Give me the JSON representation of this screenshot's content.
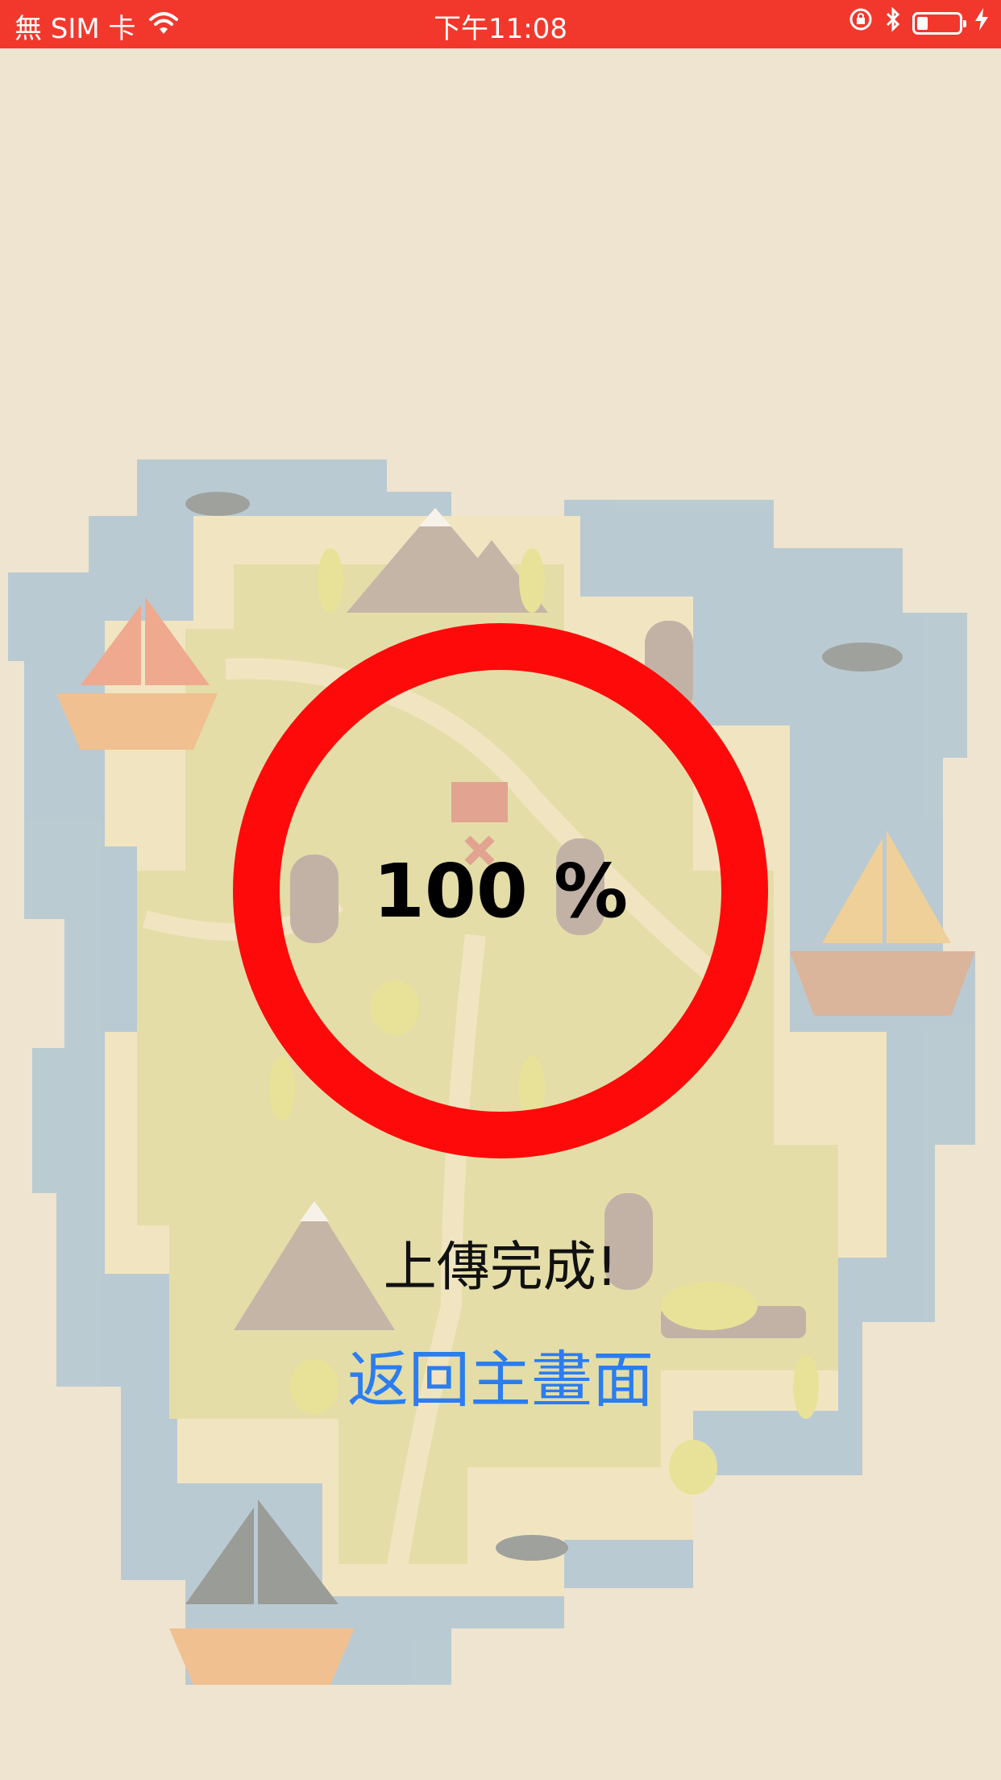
{
  "status_bar": {
    "carrier": "無 SIM 卡",
    "time": "下午11:08",
    "battery_level": 0.25,
    "icons": [
      "wifi-icon",
      "rotation-lock-icon",
      "bluetooth-icon",
      "battery-icon",
      "charging-icon"
    ]
  },
  "progress": {
    "value": 1.0,
    "label": "100 %",
    "ring_color": "#ff0a0a"
  },
  "message": {
    "status": "上傳完成!",
    "home_link": "返回主畫面",
    "link_color": "#2b7df0"
  },
  "background": {
    "description_icons": [
      "treasure-map",
      "ship-icon",
      "whale-icon",
      "mountain-icon",
      "tree-icon",
      "treasure-chest-icon"
    ]
  }
}
